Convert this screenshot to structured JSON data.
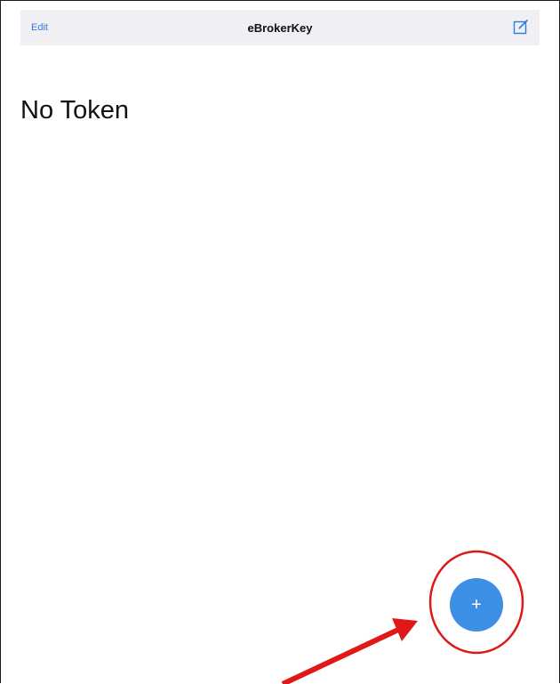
{
  "nav": {
    "edit_label": "Edit",
    "title": "eBrokerKey",
    "compose_icon": "compose-icon"
  },
  "main": {
    "empty_text": "No Token"
  },
  "fab": {
    "label": "+"
  },
  "colors": {
    "accent": "#3d8fe6",
    "link": "#2a7de1",
    "navbar_bg": "#efeff4",
    "annotation": "#e01818"
  }
}
